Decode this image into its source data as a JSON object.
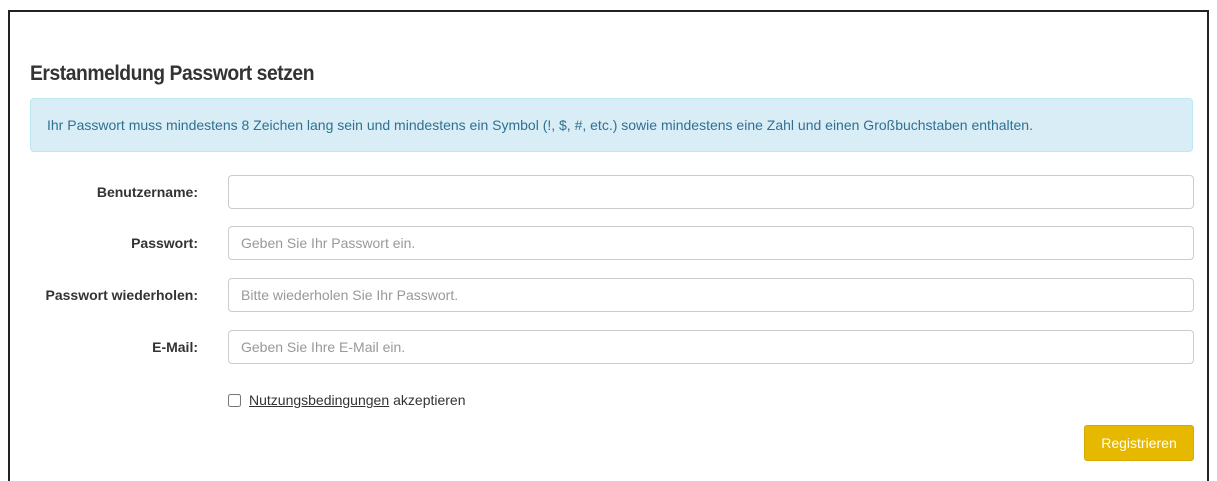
{
  "page": {
    "title": "Erstanmeldung Passwort setzen"
  },
  "alert": {
    "message": "Ihr Passwort muss mindestens 8 Zeichen lang sein und mindestens ein Symbol (!, $, #, etc.) sowie mindestens eine Zahl und einen Großbuchstaben enthalten."
  },
  "form": {
    "fields": [
      {
        "label": "Benutzername:",
        "value": "",
        "placeholder": ""
      },
      {
        "label": "Passwort:",
        "value": "",
        "placeholder": "Geben Sie Ihr Passwort ein."
      },
      {
        "label": "Passwort wiederholen:",
        "value": "",
        "placeholder": "Bitte wiederholen Sie Ihr Passwort."
      },
      {
        "label": "E-Mail:",
        "value": "",
        "placeholder": "Geben Sie Ihre E-Mail ein."
      }
    ],
    "terms": {
      "link_text": "Nutzungsbedingungen",
      "suffix_text": "akzeptieren",
      "checked": false
    },
    "submit_label": "Registrieren"
  },
  "colors": {
    "alert_background": "#d9edf7",
    "alert_text": "#31708f",
    "button_background": "#e6b800"
  }
}
